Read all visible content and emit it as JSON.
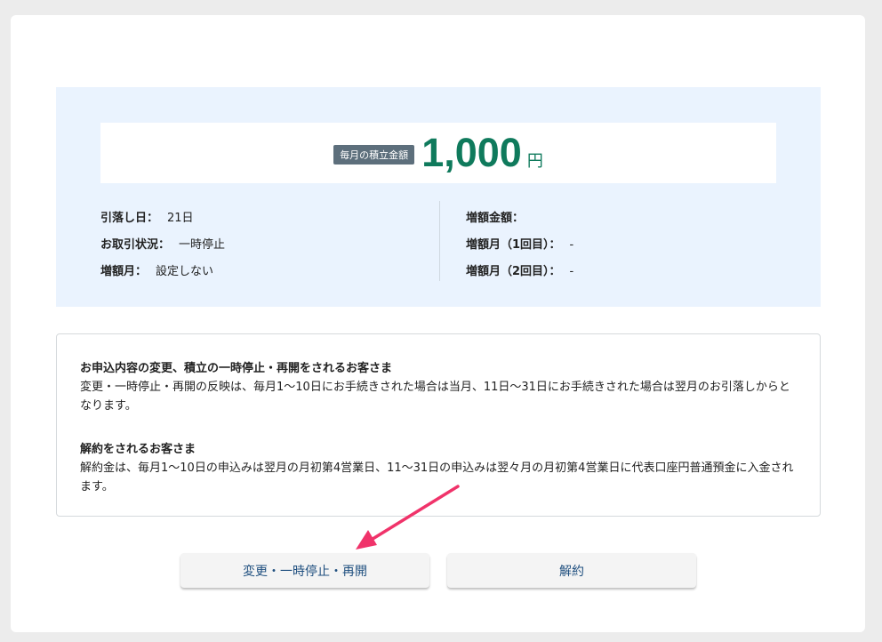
{
  "summary": {
    "badge": "毎月の積立金額",
    "amount": "1,000",
    "unit": "円",
    "left": [
      {
        "label": "引落し日：",
        "value": "21日"
      },
      {
        "label": "お取引状況：",
        "value": "一時停止"
      },
      {
        "label": "増額月：",
        "value": "設定しない"
      }
    ],
    "right": [
      {
        "label": "増額金額：",
        "value": ""
      },
      {
        "label": "増額月（1回目）：",
        "value": "-"
      },
      {
        "label": "増額月（2回目）：",
        "value": "-"
      }
    ]
  },
  "notice": {
    "change_title": "お申込内容の変更、積立の一時停止・再開をされるお客さま",
    "change_text": "変更・一時停止・再開の反映は、毎月1～10日にお手続きされた場合は当月、11日～31日にお手続きされた場合は翌月のお引落しからとなります。",
    "cancel_title": "解約をされるお客さま",
    "cancel_text": "解約金は、毎月1～10日の申込みは翌月の月初第4営業日、11～31日の申込みは翌々月の月初第4営業日に代表口座円普通預金に入金されます。"
  },
  "buttons": {
    "change_label": "変更・一時停止・再開",
    "cancel_label": "解約"
  },
  "colors": {
    "amount": "#0f7a5c",
    "summary_bg": "#eaf3fe",
    "arrow": "#f0336a"
  }
}
